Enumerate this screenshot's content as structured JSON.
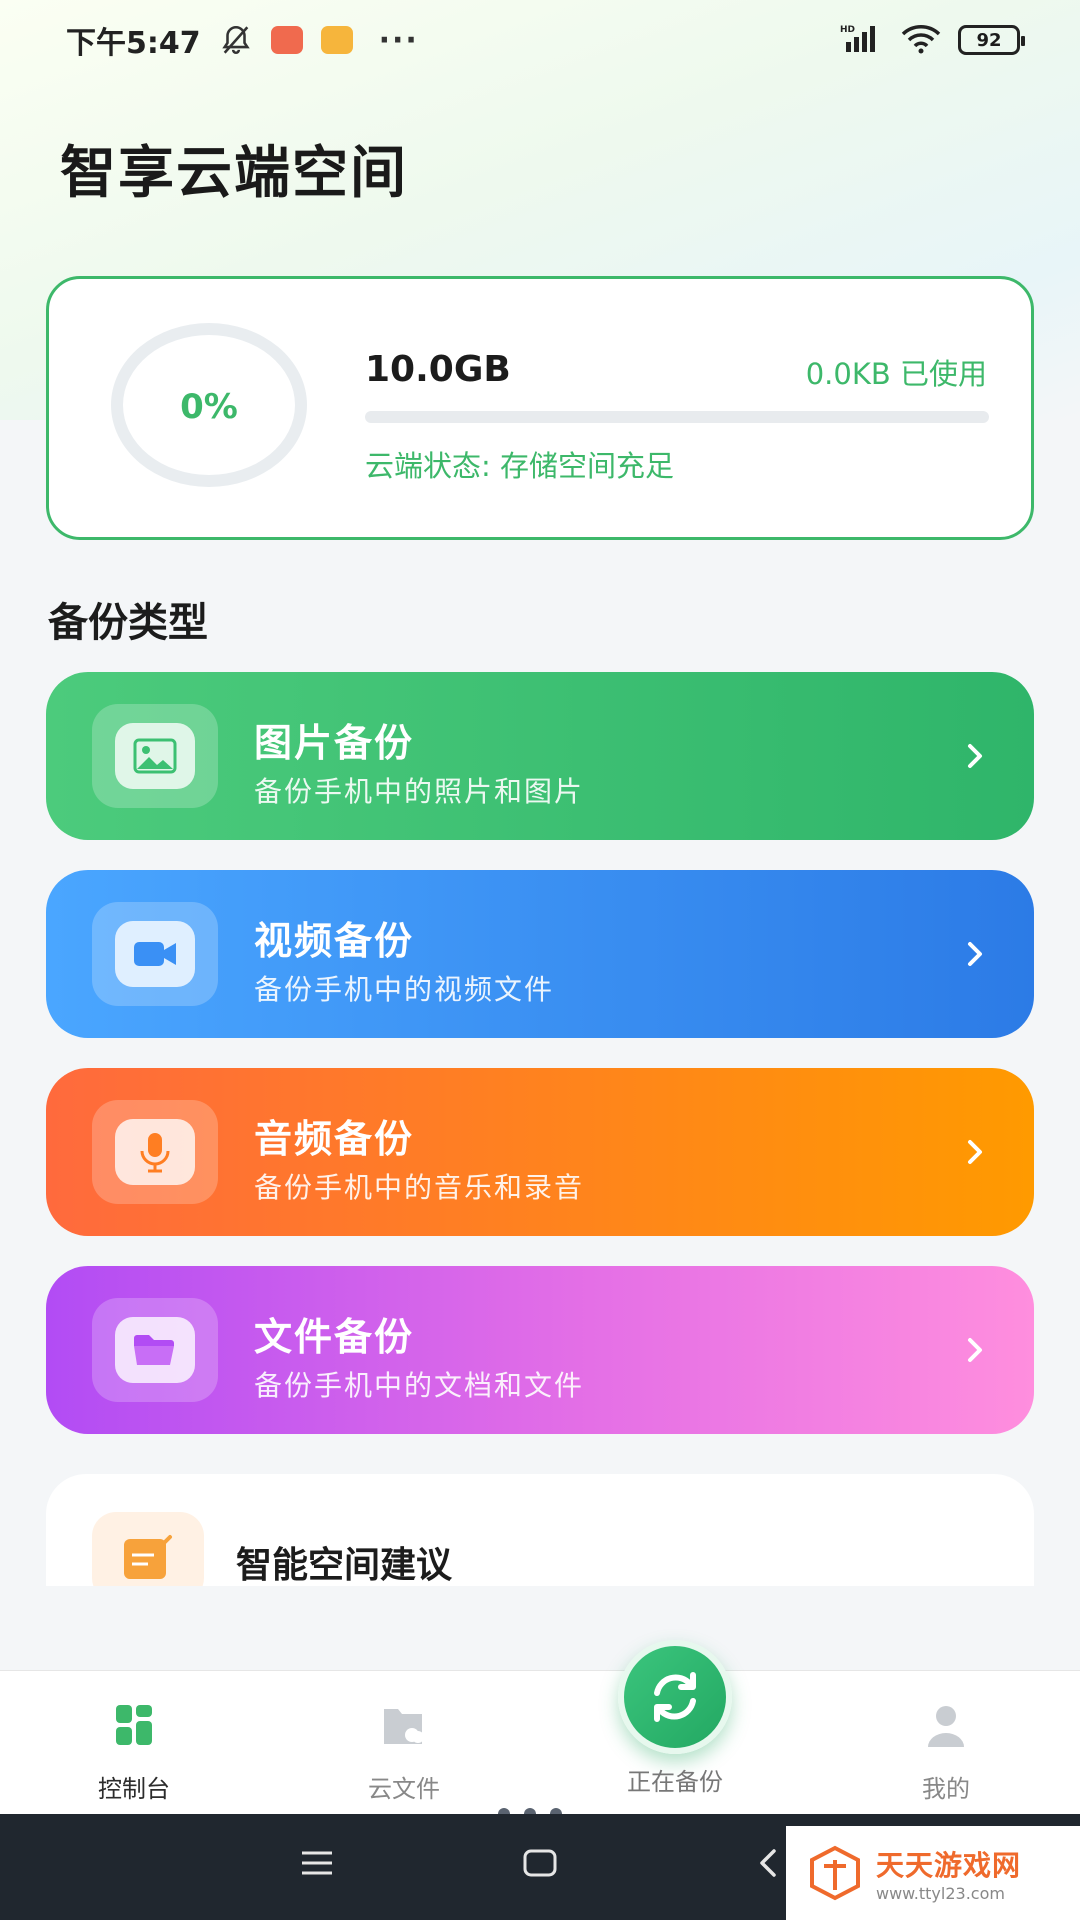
{
  "status_bar": {
    "time": "下午5:47",
    "icons": [
      "bell-off-icon",
      "app-badge-red",
      "app-badge-yellow",
      "more-dots-icon",
      "hd-signal-icon",
      "wifi-icon",
      "battery-icon"
    ],
    "more": "···",
    "battery": "92"
  },
  "header": {
    "title": "智享云端空间"
  },
  "storage": {
    "percent_label": "0%",
    "total": "10.0GB",
    "used": "0.0KB 已使用",
    "used_fraction": 0,
    "status": "云端状态: 存储空间充足",
    "accent": "#3db86a"
  },
  "section": {
    "title": "备份类型"
  },
  "backup_cards": [
    {
      "title": "图片备份",
      "subtitle": "备份手机中的照片和图片",
      "icon": "image-icon"
    },
    {
      "title": "视频备份",
      "subtitle": "备份手机中的视频文件",
      "icon": "video-camera-icon"
    },
    {
      "title": "音频备份",
      "subtitle": "备份手机中的音乐和录音",
      "icon": "microphone-icon"
    },
    {
      "title": "文件备份",
      "subtitle": "备份手机中的文档和文件",
      "icon": "folder-icon"
    }
  ],
  "suggestion": {
    "title": "智能空间建议",
    "icon": "note-edit-icon"
  },
  "bottom_nav": {
    "items": [
      {
        "label": "控制台",
        "icon": "dashboard-icon",
        "active": true
      },
      {
        "label": "云文件",
        "icon": "cloud-folder-icon",
        "active": false
      },
      {
        "label": "正在备份",
        "icon": "sync-icon",
        "active": false
      },
      {
        "label": "我的",
        "icon": "user-icon",
        "active": false
      }
    ]
  },
  "watermark": {
    "title": "天天游戏网",
    "url": "www.ttyl23.com"
  },
  "colors": {
    "photo": "#3cc072",
    "video": "#3a90f5",
    "audio": "#ff7e22",
    "file": "#d35ef0"
  }
}
